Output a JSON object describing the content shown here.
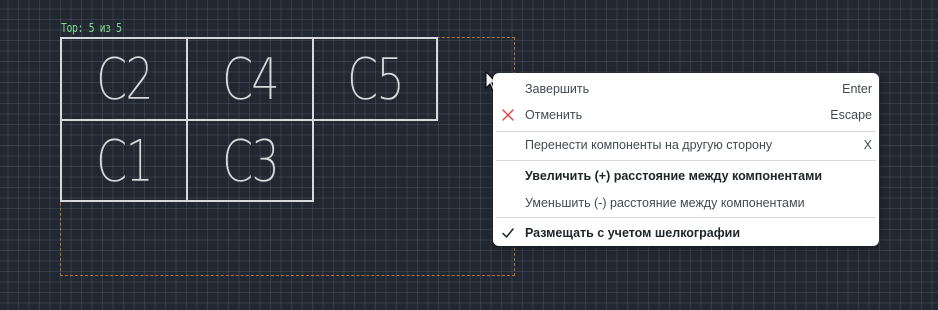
{
  "layer_label": "Top: 5 из 5",
  "components": [
    "C2",
    "C4",
    "C5",
    "C1",
    "C3"
  ],
  "menu": {
    "items": [
      {
        "label": "Завершить",
        "shortcut": "Enter"
      },
      {
        "label": "Отменить",
        "shortcut": "Escape",
        "icon": "close-icon"
      },
      {
        "label": "Перенести компоненты на другую сторону",
        "shortcut": "X"
      },
      {
        "label": "Увеличить (+) расстояние между компонентами"
      },
      {
        "label": "Уменьшить (-) расстояние между компонентами"
      },
      {
        "label": "Размещать с учетом шелкографии",
        "icon": "check-icon",
        "checked": true
      }
    ]
  },
  "colors": {
    "background": "#222831",
    "layer_label": "#7fd98b",
    "component_outline": "#d6d9dc",
    "selection_outline": "#b0762f",
    "cancel_icon": "#e0443f"
  }
}
